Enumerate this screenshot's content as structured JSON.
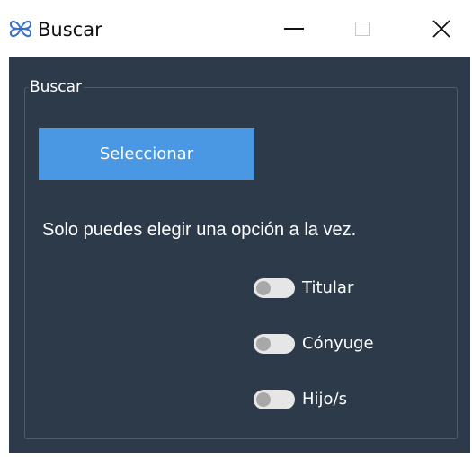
{
  "window": {
    "title": "Buscar",
    "icon": "butterfly-logo-icon",
    "controls": {
      "minimize": "minimize-icon",
      "maximize": "maximize-icon",
      "close": "close-icon"
    }
  },
  "group": {
    "legend": "Buscar",
    "select_button_label": "Seleccionar",
    "info_text": "Solo puedes elegir una opción a la vez.",
    "options": [
      {
        "label": "Titular",
        "checked": false
      },
      {
        "label": "Cónyuge",
        "checked": false
      },
      {
        "label": "Hijo/s",
        "checked": false
      }
    ]
  },
  "colors": {
    "client_bg": "#2c3a4a",
    "button_bg": "#4a98e4",
    "text": "#ffffff",
    "toggle_track": "#e6e6e6",
    "toggle_knob": "#a8a8a8"
  }
}
